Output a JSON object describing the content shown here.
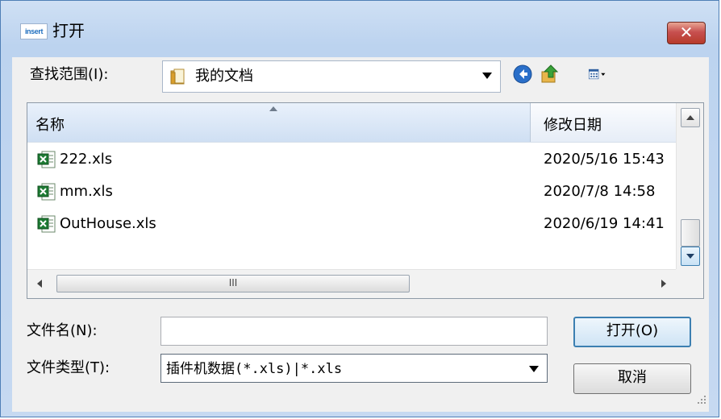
{
  "window": {
    "app_icon_text": "insert",
    "title": "打开",
    "close_glyph": "✕"
  },
  "lookin": {
    "label": "查找范围(I):",
    "value": "我的文档",
    "folder_icon": "folder-icon"
  },
  "toolbar": {
    "back_icon": "back-arrow-icon",
    "up_icon": "up-folder-icon",
    "views_icon": "view-menu-icon"
  },
  "list": {
    "columns": [
      "名称",
      "修改日期"
    ],
    "rows": [
      {
        "name": "222.xls",
        "date": "2020/5/16 15:43"
      },
      {
        "name": "mm.xls",
        "date": "2020/7/8 14:58"
      },
      {
        "name": "OutHouse.xls",
        "date": "2020/6/19 14:41"
      }
    ],
    "hscroll_grip": "III"
  },
  "filename": {
    "label": "文件名(N):",
    "value": ""
  },
  "filetype": {
    "label": "文件类型(T):",
    "value": "插件机数据(*.xls)|*.xls"
  },
  "buttons": {
    "open": "打开(O)",
    "cancel": "取消"
  },
  "colors": {
    "titlebar": "#bcd3ef",
    "close": "#c75050",
    "selected_header": "#cfdff3",
    "excel_green": "#1e7b34"
  }
}
